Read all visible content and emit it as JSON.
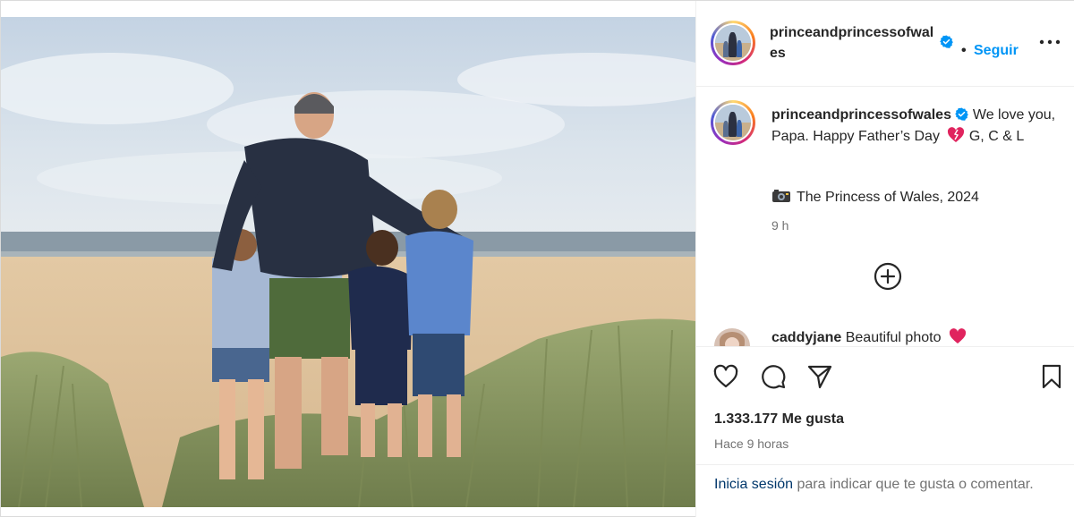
{
  "post": {
    "author": "princeandprincessofwales",
    "follow_separator": "•",
    "follow_label": "Seguir",
    "caption_user": "princeandprincessofwales",
    "caption_text_1": "We love you, Papa. Happy Father’s Day",
    "caption_text_2": "G, C & L",
    "photo_credit": "The Princess of Wales, 2024",
    "time_ago": "9 h",
    "comment_user": "caddyjane",
    "comment_text": "Beautiful photo",
    "likes": "1.333.177 Me gusta",
    "posted_when": "Hace 9 horas",
    "login_link": "Inicia sesión",
    "login_rest": "para indicar que te gusta o comentar."
  },
  "colors": {
    "accent": "#0095f6",
    "verified": "#0095f6",
    "heart": "#e0245e",
    "muted": "#737373"
  },
  "icons": {
    "verified": "verified-badge-icon",
    "more": "more-horizontal-icon",
    "camera": "camera-icon",
    "plus": "add-circle-icon",
    "like": "heart-outline-icon",
    "comment": "comment-bubble-icon",
    "share": "paper-plane-icon",
    "save": "bookmark-icon"
  }
}
